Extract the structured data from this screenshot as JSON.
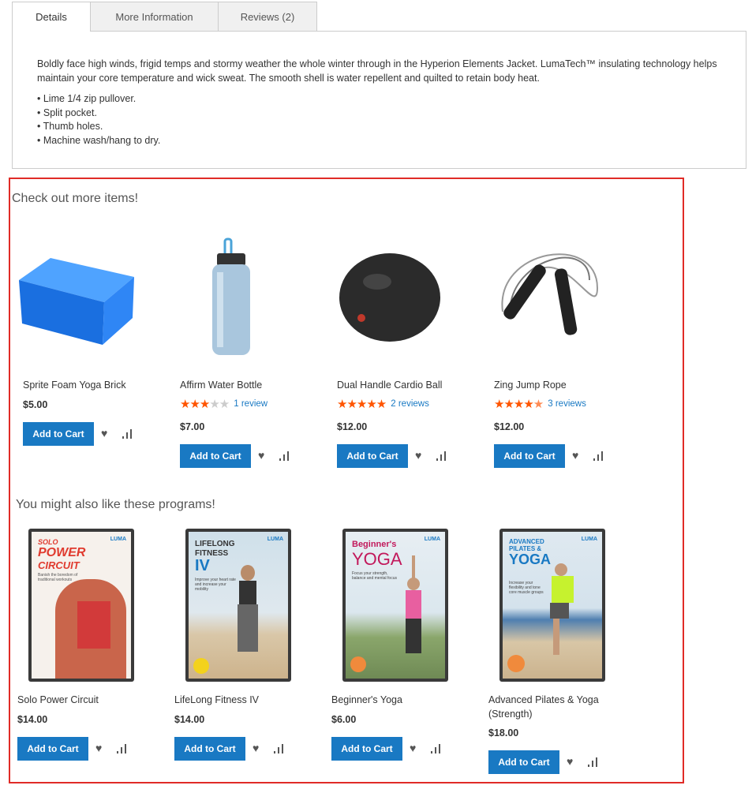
{
  "tabs": [
    {
      "label": "Details"
    },
    {
      "label": "More Information"
    },
    {
      "label": "Reviews (2)"
    }
  ],
  "details": {
    "paragraph": "Boldly face high winds, frigid temps and stormy weather the whole winter through in the Hyperion Elements Jacket. LumaTech™ insulating technology helps maintain your core temperature and wick sweat. The smooth shell is water repellent and quilted to retain body heat.",
    "bullets": [
      "Lime 1/4 zip pullover.",
      "Split pocket.",
      "Thumb holes.",
      "Machine wash/hang to dry."
    ]
  },
  "section1": {
    "title": "Check out more items!",
    "products": [
      {
        "name": "Sprite Foam Yoga Brick",
        "price": "$5.00",
        "button": "Add to Cart"
      },
      {
        "name": "Affirm Water Bottle",
        "price": "$7.00",
        "rating": 0.6,
        "reviews": "1 review",
        "button": "Add to Cart"
      },
      {
        "name": "Dual Handle Cardio Ball",
        "price": "$12.00",
        "rating": 1.0,
        "reviews": "2 reviews",
        "button": "Add to Cart"
      },
      {
        "name": "Zing Jump Rope",
        "price": "$12.00",
        "rating": 0.9,
        "reviews": "3 reviews",
        "button": "Add to Cart"
      }
    ]
  },
  "section2": {
    "title": "You might also like these programs!",
    "products": [
      {
        "name": "Solo Power Circuit",
        "price": "$14.00",
        "button": "Add to Cart",
        "cover": {
          "brand": "LUMA",
          "title1": "SOLO",
          "title2": "POWER",
          "title3": "CIRCUIT",
          "sub": "Banish the boredom of traditional workouts"
        }
      },
      {
        "name": "LifeLong Fitness IV",
        "price": "$14.00",
        "button": "Add to Cart",
        "cover": {
          "brand": "LUMA",
          "title1": "LIFELONG",
          "title2": "FITNESS",
          "title3": "IV",
          "sub": "Improve your heart rate and increase your mobility"
        }
      },
      {
        "name": "Beginner's Yoga",
        "price": "$6.00",
        "button": "Add to Cart",
        "cover": {
          "brand": "LUMA",
          "title1": "Beginner's",
          "title2": "YOGA",
          "title3": "",
          "sub": "Focus your strength, balance and mental focus"
        }
      },
      {
        "name": "Advanced Pilates & Yoga (Strength)",
        "price": "$18.00",
        "button": "Add to Cart",
        "cover": {
          "brand": "LUMA",
          "title1": "ADVANCED",
          "title2": "PILATES &",
          "title3": "YOGA",
          "sub": "Increase your flexibility and tone core muscle groups"
        }
      }
    ]
  },
  "colors": {
    "accent": "#1979c3",
    "star": "#ff5501",
    "highlight": "#e02b27"
  }
}
